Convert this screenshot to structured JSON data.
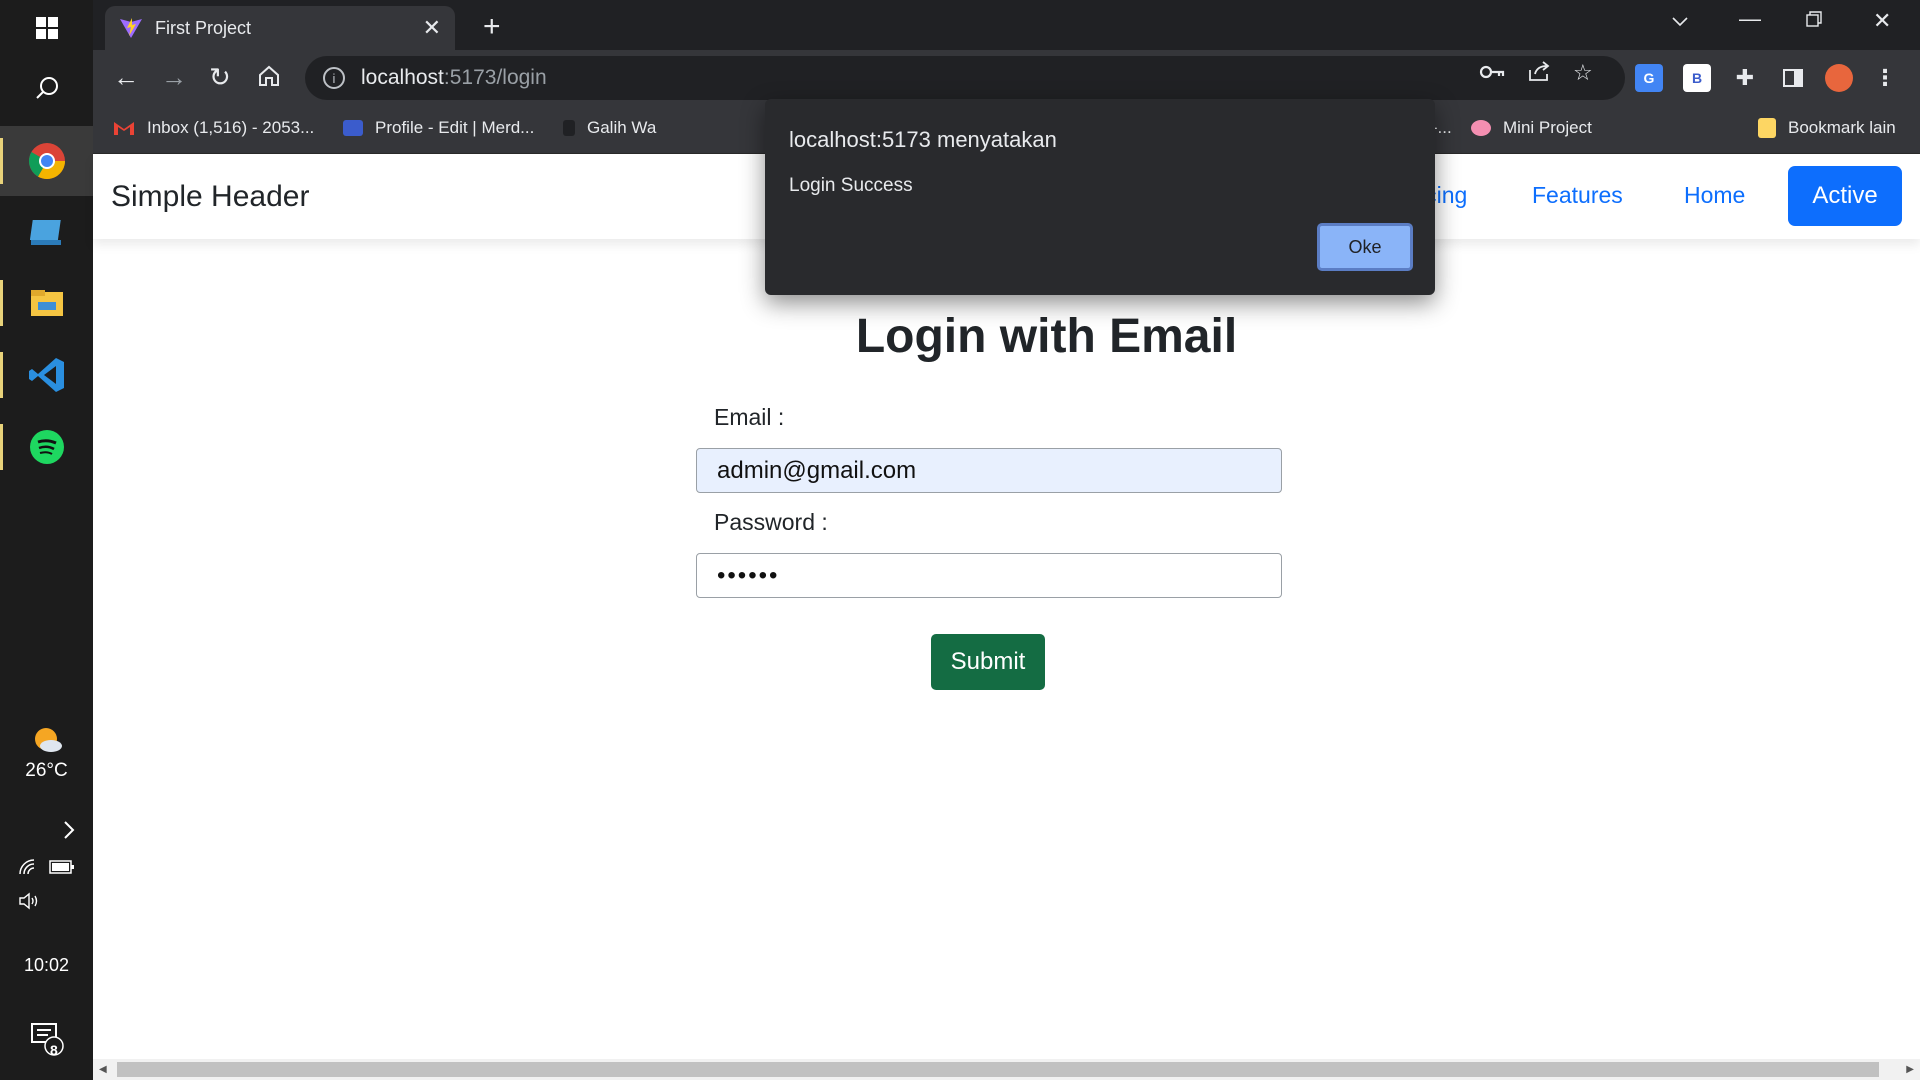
{
  "taskbar": {
    "weather_temp": "26°C",
    "time": "10:02",
    "notification_count": "8"
  },
  "browser": {
    "tab_title": "First Project",
    "url_host": "localhost",
    "url_path": ":5173/login",
    "bookmarks": [
      "Inbox (1,516) - 2053...",
      "Profile - Edit | Merd...",
      "Galih Wa",
      "aran Rapat -...",
      "Mini Project",
      "Bookmark lain"
    ]
  },
  "page": {
    "brand": "Simple Header",
    "nav": [
      "Pricing",
      "Features",
      "Home",
      "Active"
    ],
    "title": "Login with Email",
    "email_label": "Email :",
    "email_value": "admin@gmail.com",
    "password_label": "Password :",
    "password_value": "••••••",
    "submit_label": "Submit"
  },
  "dialog": {
    "title": "localhost:5173 menyatakan",
    "message": "Login Success",
    "ok_label": "Oke"
  },
  "colors": {
    "primary": "#0d6efd",
    "submit": "#146c43",
    "dialog_bg": "#292a2d",
    "ok_button": "#8ab4f8"
  }
}
